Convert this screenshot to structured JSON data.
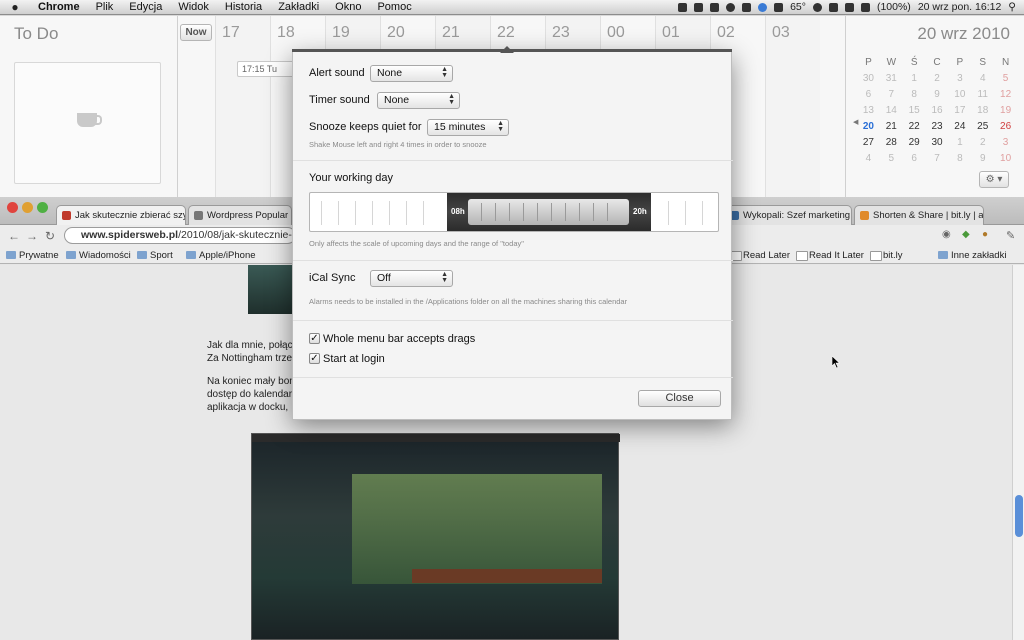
{
  "menubar": {
    "apple": "",
    "items": [
      "Chrome",
      "Plik",
      "Edycja",
      "Widok",
      "Historia",
      "Zakładki",
      "Okno",
      "Pomoc"
    ],
    "status": {
      "temp": "65°",
      "battery": "(100%)",
      "datetime": "20 wrz pon.  16:12"
    }
  },
  "timeline": {
    "todo_title": "To Do",
    "now_label": "Now",
    "hours": [
      "17",
      "18",
      "19",
      "20",
      "21",
      "22",
      "23",
      "00",
      "01",
      "02",
      "03"
    ],
    "event_chip": "17:15  Tu",
    "calendar": {
      "date": "20 wrz 2010",
      "weekdays": [
        "P",
        "W",
        "Ś",
        "C",
        "P",
        "S",
        "N"
      ],
      "weeks": [
        [
          "30",
          "31",
          "1",
          "2",
          "3",
          "4",
          "5"
        ],
        [
          "6",
          "7",
          "8",
          "9",
          "10",
          "11",
          "12"
        ],
        [
          "13",
          "14",
          "15",
          "16",
          "17",
          "18",
          "19"
        ],
        [
          "20",
          "21",
          "22",
          "23",
          "24",
          "25",
          "26"
        ],
        [
          "27",
          "28",
          "29",
          "30",
          "1",
          "2",
          "3"
        ],
        [
          "4",
          "5",
          "6",
          "7",
          "8",
          "9",
          "10"
        ]
      ],
      "gear_label": "⚙ ▾"
    }
  },
  "prefs": {
    "alert_sound_label": "Alert sound",
    "alert_sound_value": "None",
    "timer_sound_label": "Timer sound",
    "timer_sound_value": "None",
    "snooze_label": "Snooze keeps quiet for",
    "snooze_value": "15 minutes",
    "snooze_hint": "Shake Mouse left and right 4 times in order to snooze",
    "working_day_title": "Your working day",
    "working_day_start": "08h",
    "working_day_end": "20h",
    "working_day_hint": "Only affects the scale of upcoming days and the range of \"today\"",
    "ical_label": "iCal Sync",
    "ical_value": "Off",
    "ical_hint": "Alarms needs to be installed in the /Applications folder on all the machines sharing this calendar",
    "opt_drags": "Whole menu bar accepts drags",
    "opt_drags_checked": true,
    "opt_login": "Start at login",
    "opt_login_checked": true,
    "close_label": "Close"
  },
  "browser": {
    "tabs": [
      "Jak skutecznie zbierać szy",
      "Wordpress Popular Posts",
      "Wykopali: Szef marketing",
      "Shorten & Share | bit.ly | a"
    ],
    "url_host": "www.spidersweb.pl",
    "url_path": "/2010/08/jak-skutecznie-",
    "bookmarks": [
      "Prywatne",
      "Wiadomości",
      "Sport",
      "Apple/iPhone",
      "Read Later",
      "Read It Later",
      "bit.ly",
      "Inne zakładki"
    ],
    "page_lines": [
      "Jak dla mnie, połąc",
      "Za Nottingham trze",
      "Na koniec mały bon",
      "dostęp do kalendar",
      "aplikacja w docku,"
    ]
  }
}
